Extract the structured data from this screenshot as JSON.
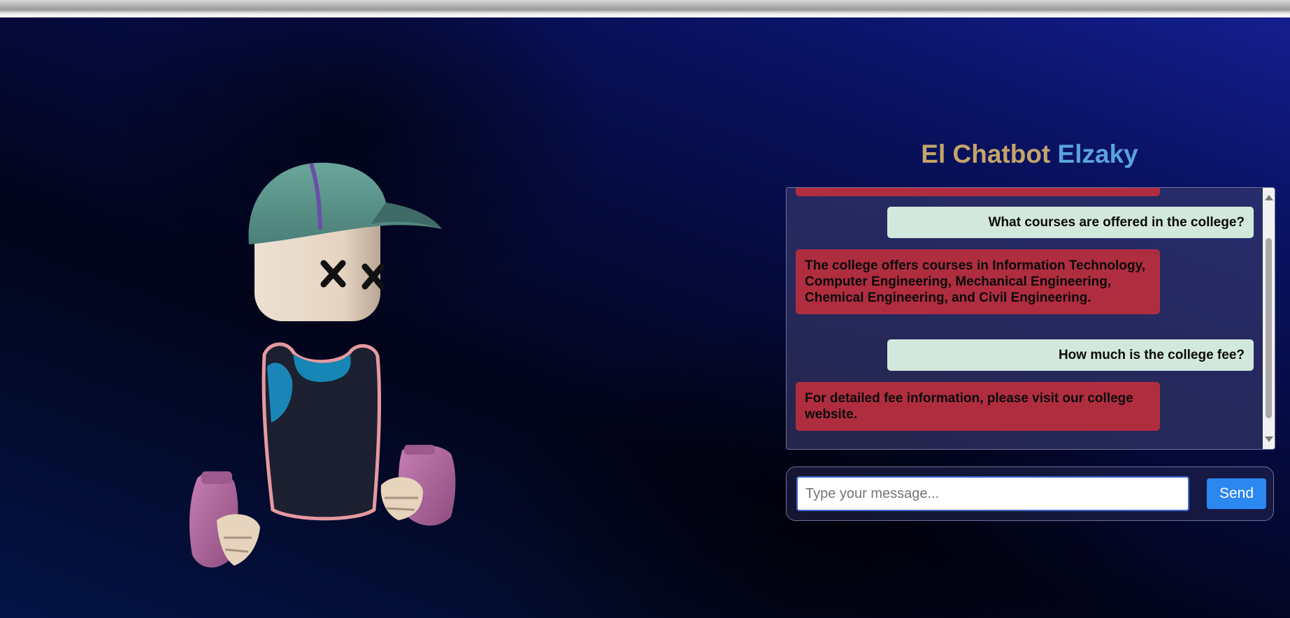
{
  "chat": {
    "title_part1": "El Chatbot",
    "title_part2": "Elzaky",
    "messages": [
      {
        "role": "bot",
        "text": ""
      },
      {
        "role": "user",
        "text": "What courses are offered in the college?"
      },
      {
        "role": "bot",
        "text": "The college offers courses in Information Technology, Computer Engineering, Mechanical Engineering, Chemical Engineering, and Civil Engineering."
      },
      {
        "role": "user",
        "text": "How much is the college fee?"
      },
      {
        "role": "bot",
        "text": "For detailed fee information, please visit our college website."
      }
    ]
  },
  "input": {
    "placeholder": "Type your message...",
    "value": "",
    "send_label": "Send"
  },
  "colors": {
    "title_part1": "#c4a46a",
    "title_part2": "#5aa3dd",
    "bot_bubble": "#b02d40",
    "user_bubble": "#d3e8dd",
    "send_button": "#2c87f0"
  },
  "avatar": {
    "icon": "3d-character-avatar",
    "eyes": "x-eyes"
  }
}
